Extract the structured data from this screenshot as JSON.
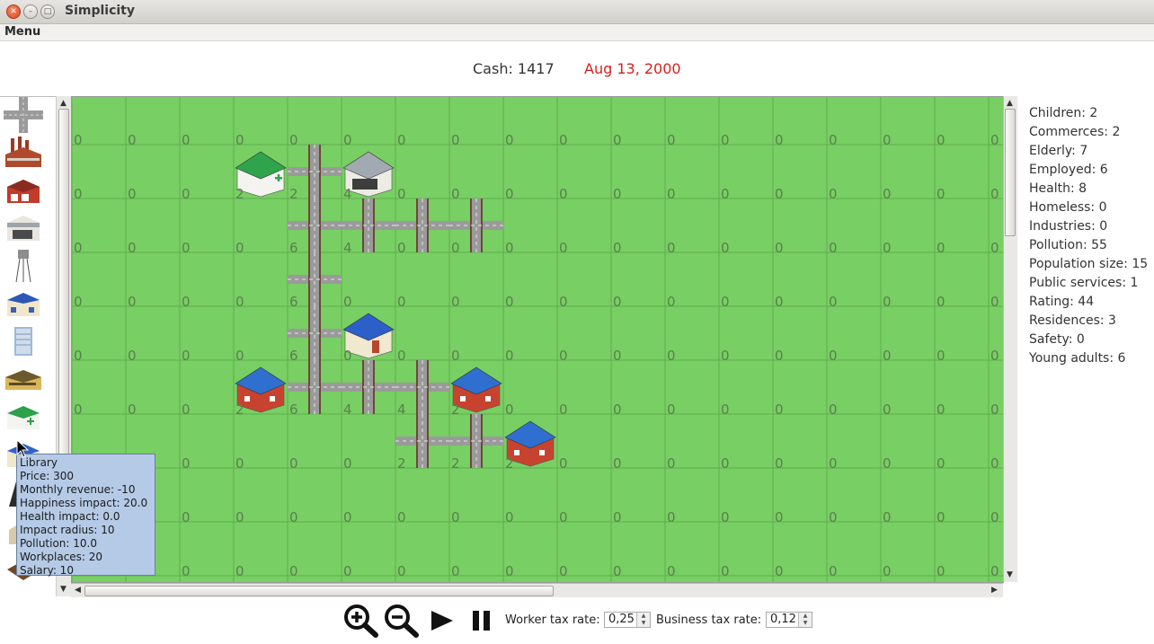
{
  "window": {
    "title": "Simplicity"
  },
  "menu": {
    "label": "Menu"
  },
  "header": {
    "cash": "Cash: 1417",
    "date": "Aug 13, 2000",
    "date_color": "#d72020"
  },
  "palette": {
    "tools": [
      "road-tool-icon",
      "factory-tool-icon",
      "fire-station-tool-icon",
      "store-tool-icon",
      "water-tower-tool-icon",
      "police-tool-icon",
      "office-tower-tool-icon",
      "school-tool-icon",
      "hospital-tool-icon",
      "library-tool-icon",
      "monument-tool-icon",
      "house-tool-icon",
      "stadium-tool-icon"
    ]
  },
  "map": {
    "grass_color": "#78cf63",
    "grid": [
      [
        "0",
        "0",
        "0",
        "0",
        "0",
        "0",
        "0",
        "0",
        "0",
        "0",
        "0",
        "0",
        "0",
        "0",
        "0",
        "0",
        "0",
        "0"
      ],
      [
        "0",
        "0",
        "0",
        "2",
        "2",
        "4",
        "0",
        "0",
        "0",
        "0",
        "0",
        "0",
        "0",
        "0",
        "0",
        "0",
        "0",
        "0"
      ],
      [
        "0",
        "0",
        "0",
        "0",
        "6",
        "4",
        "0",
        "0",
        "0",
        "0",
        "0",
        "0",
        "0",
        "0",
        "0",
        "0",
        "0",
        "0"
      ],
      [
        "0",
        "0",
        "0",
        "0",
        "6",
        "0",
        "0",
        "0",
        "0",
        "0",
        "0",
        "0",
        "0",
        "0",
        "0",
        "0",
        "0",
        "0"
      ],
      [
        "0",
        "0",
        "0",
        "0",
        "6",
        "0",
        "0",
        "0",
        "0",
        "0",
        "0",
        "0",
        "0",
        "0",
        "0",
        "0",
        "0",
        "0"
      ],
      [
        "0",
        "0",
        "0",
        "2",
        "6",
        "4",
        "4",
        "2",
        "0",
        "0",
        "0",
        "0",
        "0",
        "0",
        "0",
        "0",
        "0",
        "0"
      ],
      [
        "",
        "",
        "0",
        "0",
        "0",
        "0",
        "2",
        "2",
        "2",
        "0",
        "0",
        "0",
        "0",
        "0",
        "0",
        "0",
        "0",
        "0"
      ],
      [
        "",
        "",
        "0",
        "0",
        "0",
        "0",
        "0",
        "0",
        "0",
        "0",
        "0",
        "0",
        "0",
        "0",
        "0",
        "0",
        "0",
        "0"
      ],
      [
        "",
        "",
        "0",
        "0",
        "0",
        "0",
        "0",
        "0",
        "0",
        "0",
        "0",
        "0",
        "0",
        "0",
        "0",
        "0",
        "0",
        "0"
      ]
    ]
  },
  "stats": [
    "Children: 2",
    "Commerces: 2",
    "Elderly: 7",
    "Employed: 6",
    "Health: 8",
    "Homeless: 0",
    "Industries: 0",
    "Pollution: 55",
    "Population size: 15",
    "Public services: 1",
    "Rating: 44",
    "Residences: 3",
    "Safety: 0",
    "Young adults: 6"
  ],
  "tooltip": [
    "Library",
    "Price: 300",
    "Monthly revenue: -10",
    "Happiness impact: 20.0",
    "Health impact: 0.0",
    "Impact radius: 10",
    "Pollution: 10.0",
    "Workplaces: 20",
    "Salary: 10"
  ],
  "controls": {
    "worker_tax_label": "Worker tax rate:",
    "worker_tax_value": "0,25",
    "business_tax_label": "Business tax rate:",
    "business_tax_value": "0,12"
  }
}
